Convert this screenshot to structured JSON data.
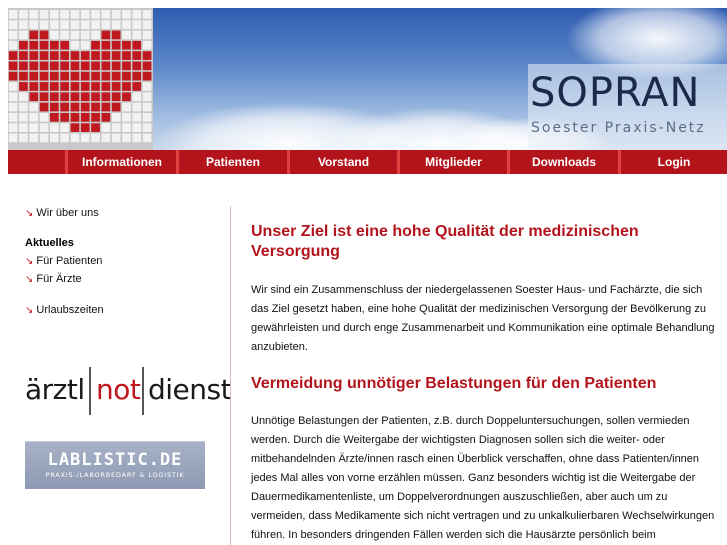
{
  "header": {
    "logo_main": "SOPRAN",
    "logo_sub": "Soester Praxis-Netz",
    "brand_color": "#b3141c"
  },
  "nav": {
    "items": [
      {
        "label": "Informationen"
      },
      {
        "label": "Patienten"
      },
      {
        "label": "Vorstand"
      },
      {
        "label": "Mitglieder"
      },
      {
        "label": "Downloads"
      },
      {
        "label": "Login"
      }
    ]
  },
  "sidebar": {
    "arrow": "↘",
    "about": "Wir über uns",
    "news_heading": "Aktuelles",
    "for_patients": "Für Patienten",
    "for_doctors": "Für Ärzte",
    "vacations": "Urlaubszeiten",
    "notdienst": {
      "part1": "ärztl",
      "part2": "not",
      "part3": "dienst"
    },
    "lablistic": {
      "main": "LABLISTIC.DE",
      "sub": "PRAXIS-/LABORBEDARF & LOGISTIK"
    }
  },
  "main": {
    "heading1": "Unser Ziel ist eine hohe Qualität der medizinischen Versorgung",
    "para1": "Wir sind ein Zusammenschluss der niedergelassenen Soester Haus- und Fachärzte, die sich das Ziel gesetzt haben, eine hohe Qualität der medizinischen Versorgung der Bevölkerung zu gewährleisten und durch enge Zusammenarbeit und Kommunikation eine optimale Behandlung anzubieten.",
    "heading2": "Vermeidung unnötiger Belastungen für den Patienten",
    "para2": "Unnötige Belastungen der Patienten, z.B. durch Doppeluntersuchungen, sollen vermieden werden. Durch die Weitergabe der wichtigsten Diagnosen sollen sich die weiter- oder mitbehandelnden Ärzte/innen rasch einen Überblick verschaffen, ohne dass Patienten/innen jedes Mal alles von vorne erzählen müssen. Ganz besonders wichtig ist die Weitergabe der Dauermedikamentenliste, um Doppelverordnungen auszuschließen, aber auch um zu vermeiden, dass Medikamente sich nicht vertragen und zu unkalkulierbaren Wechselwirkungen führen. In besonders dringenden Fällen werden sich die Hausärzte persönlich beim hinzuzuziehenden Facharzt oder der Fachärztin um einen kurzfristigen"
  }
}
